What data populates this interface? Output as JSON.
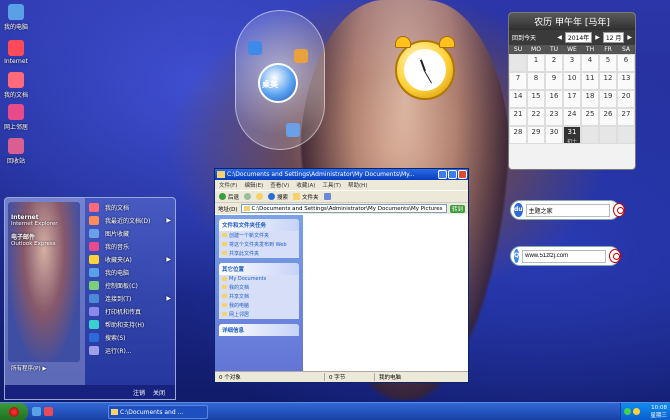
{
  "desktop": {
    "icons": [
      {
        "label": "我的电脑"
      },
      {
        "label": "Internet"
      },
      {
        "label": "我的文档"
      },
      {
        "label": "网上邻居"
      },
      {
        "label": "回收站"
      }
    ]
  },
  "launcher": {
    "label": "桌美"
  },
  "calendar": {
    "title": "农历 甲午年 [马年]",
    "back_today": "回到今天",
    "year": "2014年",
    "month": "12 月",
    "weekdays": [
      "SU",
      "MO",
      "TU",
      "WE",
      "TH",
      "FR",
      "SA"
    ],
    "weeks": [
      [
        {
          "d": ""
        },
        {
          "d": "1"
        },
        {
          "d": "2"
        },
        {
          "d": "3"
        },
        {
          "d": "4"
        },
        {
          "d": "5"
        },
        {
          "d": "6"
        }
      ],
      [
        {
          "d": "7"
        },
        {
          "d": "8"
        },
        {
          "d": "9"
        },
        {
          "d": "10"
        },
        {
          "d": "11"
        },
        {
          "d": "12"
        },
        {
          "d": "13"
        }
      ],
      [
        {
          "d": "14"
        },
        {
          "d": "15"
        },
        {
          "d": "16"
        },
        {
          "d": "17"
        },
        {
          "d": "18"
        },
        {
          "d": "19"
        },
        {
          "d": "20"
        }
      ],
      [
        {
          "d": "21"
        },
        {
          "d": "22"
        },
        {
          "d": "23"
        },
        {
          "d": "24"
        },
        {
          "d": "25"
        },
        {
          "d": "26"
        },
        {
          "d": "27"
        }
      ],
      [
        {
          "d": "28"
        },
        {
          "d": "29"
        },
        {
          "d": "30"
        },
        {
          "d": "31"
        },
        {
          "d": ""
        },
        {
          "d": ""
        },
        {
          "d": ""
        }
      ]
    ],
    "today": "31",
    "today_sub": "初十"
  },
  "search1": {
    "logo": "du",
    "placeholder": "",
    "value": "主题之家"
  },
  "search2": {
    "logo": "Q",
    "value": "www.51ztzj.com"
  },
  "explorer": {
    "title": "C:\\Documents and Settings\\Administrator\\My Documents\\My...",
    "menu": [
      "文件(F)",
      "编辑(E)",
      "查看(V)",
      "收藏(A)",
      "工具(T)",
      "帮助(H)"
    ],
    "toolbar": {
      "back": "后退",
      "search": "搜索",
      "folders": "文件夹"
    },
    "address_label": "地址(D)",
    "address": "C:\\Documents and Settings\\Administrator\\My Documents\\My Pictures",
    "go": "转到",
    "tasks_title": "文件和文件夹任务",
    "tasks": [
      "创建一个新文件夹",
      "将这个文件夹发布到 Web",
      "共享此文件夹"
    ],
    "places_title": "其它位置",
    "places": [
      "My Documents",
      "我的文档",
      "共享文档",
      "我的电脑",
      "网上邻居"
    ],
    "details_title": "详细信息",
    "status_objects": "0 个对象",
    "status_size": "0 字节",
    "status_loc": "我的电脑"
  },
  "startmenu": {
    "pinned": [
      {
        "title": "Internet",
        "sub": "Internet Explorer"
      },
      {
        "title": "电子邮件",
        "sub": "Outlook Express"
      }
    ],
    "right": [
      {
        "label": "我的文档",
        "arrow": ""
      },
      {
        "label": "我最近的文档(D)",
        "arrow": "▶"
      },
      {
        "label": "图片收藏",
        "arrow": ""
      },
      {
        "label": "我的音乐",
        "arrow": ""
      },
      {
        "label": "收藏夹(A)",
        "arrow": "▶"
      },
      {
        "label": "我的电脑",
        "arrow": ""
      },
      {
        "label": "控制面板(C)",
        "arrow": ""
      },
      {
        "label": "连接到(T)",
        "arrow": "▶"
      },
      {
        "label": "打印机和传真",
        "arrow": ""
      },
      {
        "label": "帮助和支持(H)",
        "arrow": ""
      },
      {
        "label": "搜索(S)",
        "arrow": ""
      },
      {
        "label": "运行(R)...",
        "arrow": ""
      }
    ],
    "all_programs": "所有程序(P)",
    "logoff": "注销",
    "shutdown": "关闭"
  },
  "taskbar": {
    "task": "C:\\Documents and ...",
    "time": "10:08",
    "day": "星期三"
  }
}
